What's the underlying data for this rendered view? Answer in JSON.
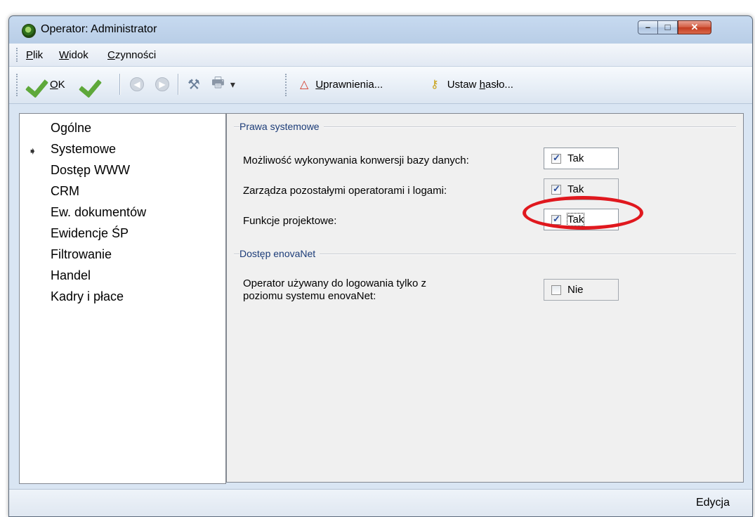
{
  "window": {
    "title": "Operator: Administrator",
    "min": "–",
    "max": "□",
    "close": "✕"
  },
  "menu": [
    {
      "pre": "",
      "key": "P",
      "post": "lik"
    },
    {
      "pre": "",
      "key": "W",
      "post": "idok"
    },
    {
      "pre": "",
      "key": "C",
      "post": "zynności"
    }
  ],
  "toolbar": {
    "ok_key": "O",
    "ok_rest": "K",
    "back_icon": "◀",
    "forward_icon": "▶",
    "tools_icon": "⚒",
    "print_icon": "🖶",
    "dropdown_icon": "▾",
    "perm_icon": "△",
    "perm_key": "U",
    "perm_rest": "prawnienia...",
    "key_icon": "⚷",
    "pass_pre": "Ustaw ",
    "pass_key": "h",
    "pass_rest": "asło..."
  },
  "nav": {
    "arrow": "➧",
    "items": [
      "Ogólne",
      "Systemowe",
      "Dostęp WWW",
      "CRM",
      "Ew. dokumentów",
      "Ewidencje ŚP",
      "Filtrowanie",
      "Handel",
      "Kadry i płace"
    ],
    "selected_index": 1
  },
  "groups": {
    "system": {
      "title": "Prawa systemowe",
      "rows": [
        {
          "label": "Możliwość wykonywania konwersji bazy danych:",
          "value": "Tak",
          "checked": true
        },
        {
          "label": "Zarządza pozostałymi operatorami i logami:",
          "value": "Tak",
          "checked": true
        },
        {
          "label": "Funkcje projektowe:",
          "value": "Tak",
          "checked": true
        }
      ]
    },
    "enova": {
      "title": "Dostęp enovaNet",
      "label_line1": "Operator używany do logowania tylko z",
      "label_line2": "poziomu systemu enovaNet:",
      "value": "Nie",
      "checked": false
    }
  },
  "status": {
    "text": "Edycja"
  }
}
